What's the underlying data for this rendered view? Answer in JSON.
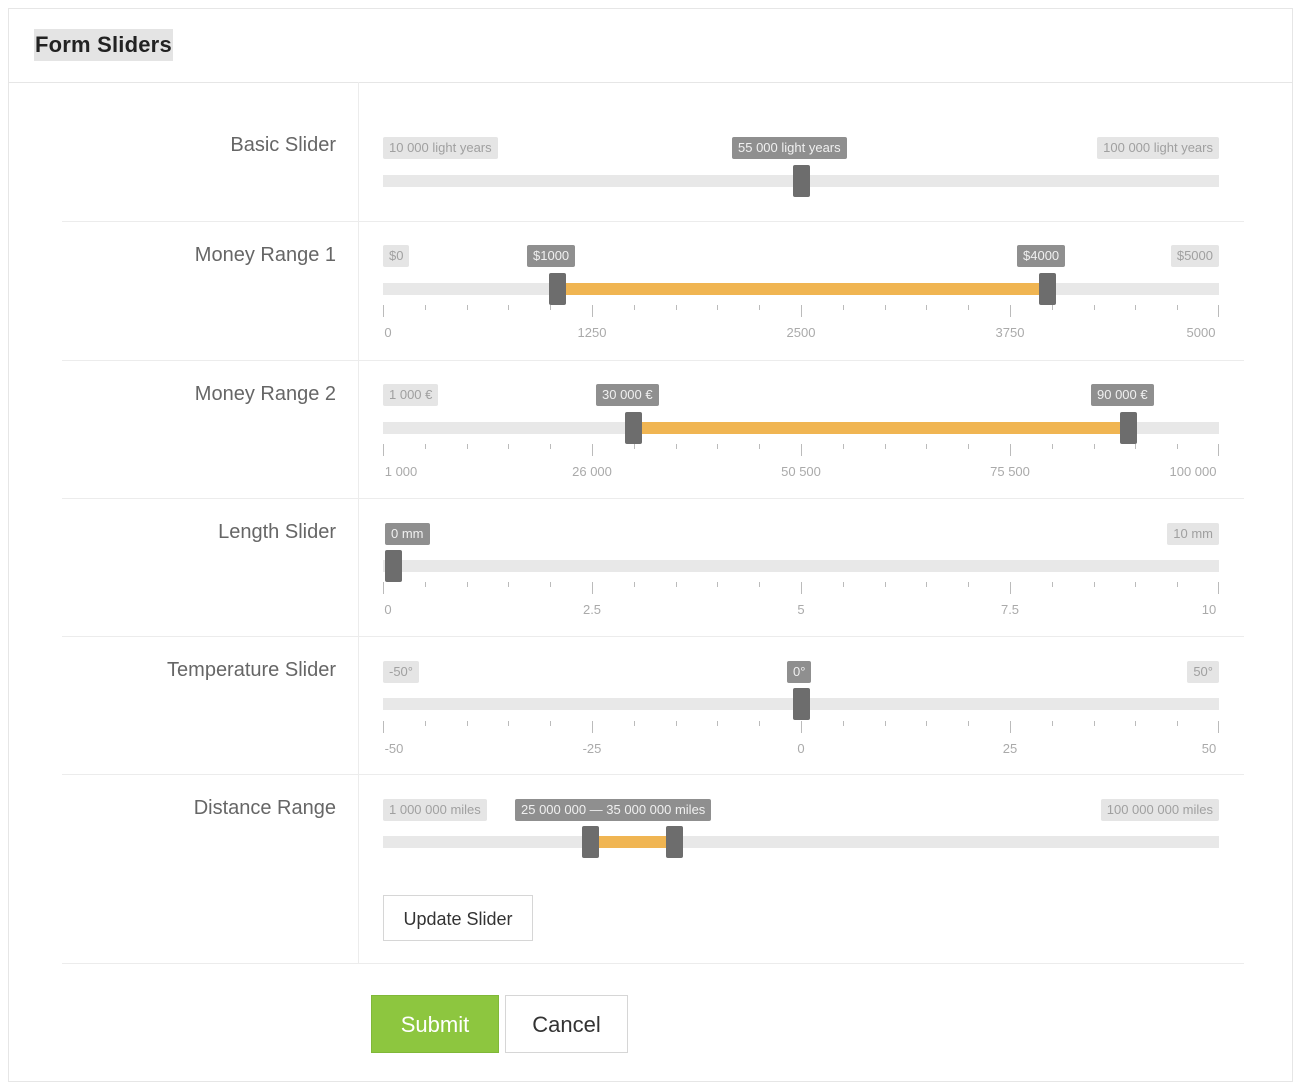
{
  "panel": {
    "title": "Form Sliders"
  },
  "sliders": [
    {
      "label": "Basic Slider",
      "min_label": "10 000 light years",
      "max_label": "100 000 light years",
      "value_label": "55 000 light years",
      "min": 10000,
      "max": 100000,
      "value": 55000
    },
    {
      "label": "Money Range 1",
      "min_label": "$0",
      "max_label": "$5000",
      "from_label": "$1000",
      "to_label": "$4000",
      "min": 0,
      "max": 5000,
      "from": 1000,
      "to": 4000,
      "ticks": [
        "0",
        "1250",
        "2500",
        "3750",
        "5000"
      ]
    },
    {
      "label": "Money Range 2",
      "min_label": "1 000 €",
      "max_label": "",
      "from_label": "30 000 €",
      "to_label": "90 000 €",
      "min": 1000,
      "max": 100000,
      "from": 30000,
      "to": 90000,
      "ticks": [
        "1 000",
        "26 000",
        "50 500",
        "75 500",
        "100 000"
      ]
    },
    {
      "label": "Length Slider",
      "min_label": "",
      "max_label": "10 mm",
      "value_label": "0 mm",
      "min": 0,
      "max": 10,
      "value": 0,
      "ticks": [
        "0",
        "2.5",
        "5",
        "7.5",
        "10"
      ]
    },
    {
      "label": "Temperature Slider",
      "min_label": "-50°",
      "max_label": "50°",
      "value_label": "0°",
      "min": -50,
      "max": 50,
      "value": 0,
      "ticks": [
        "-50",
        "-25",
        "0",
        "25",
        "50"
      ]
    },
    {
      "label": "Distance Range",
      "min_label": "1 000 000 miles",
      "max_label": "100 000 000 miles",
      "range_label": "25 000 000 — 35 000 000 miles",
      "min": 1000000,
      "max": 100000000,
      "from": 25000000,
      "to": 35000000
    }
  ],
  "buttons": {
    "update": "Update Slider",
    "submit": "Submit",
    "cancel": "Cancel"
  },
  "colors": {
    "fill": "#f0b552",
    "handle": "#6d6d6d",
    "submit": "#8dc63f"
  }
}
